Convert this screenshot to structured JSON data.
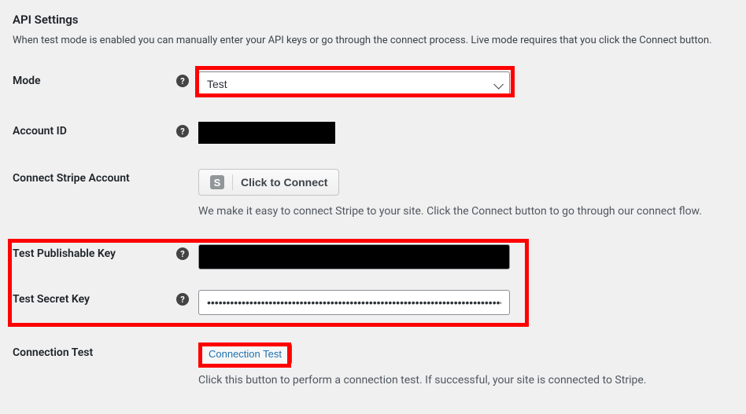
{
  "header": {
    "title": "API Settings",
    "description": "When test mode is enabled you can manually enter your API keys or go through the connect process. Live mode requires that you click the Connect button."
  },
  "fields": {
    "mode": {
      "label": "Mode",
      "value": "Test"
    },
    "account_id": {
      "label": "Account ID"
    },
    "connect": {
      "label": "Connect Stripe Account",
      "button": "Click to Connect",
      "description": "We make it easy to connect Stripe to your site. Click the Connect button to go through our connect flow."
    },
    "test_pub": {
      "label": "Test Publishable Key"
    },
    "test_secret": {
      "label": "Test Secret Key",
      "value": "••••••••••••••••••••••••••••••••••••••••••••••••••••••••••••••••••••••••••••••••••••••••••••••••••••••••••"
    },
    "conn_test": {
      "label": "Connection Test",
      "button": "Connection Test",
      "description": "Click this button to perform a connection test. If successful, your site is connected to Stripe."
    }
  }
}
